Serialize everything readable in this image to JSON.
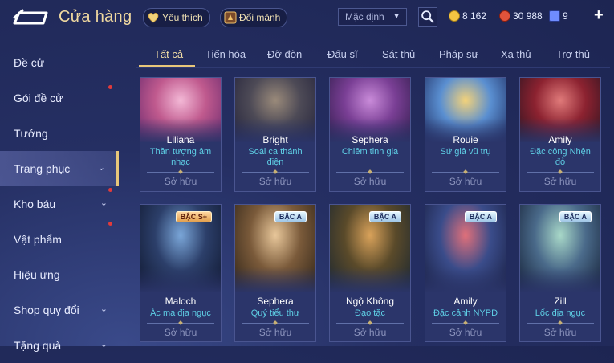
{
  "header": {
    "title": "Cửa hàng",
    "favorites_label": "Yêu thích",
    "exchange_label": "Đổi mảnh",
    "sort_selected": "Mặc định",
    "currencies": [
      {
        "name": "gold-coin",
        "value": "8 162",
        "color": "#f5c542"
      },
      {
        "name": "red-gem",
        "value": "30 988",
        "color": "#e2533b"
      },
      {
        "name": "voucher",
        "value": "9",
        "color": "#6f8cff"
      }
    ]
  },
  "sidebar": {
    "items": [
      {
        "label": "Đề cử"
      },
      {
        "label": "Gói đề cử"
      },
      {
        "label": "Tướng"
      },
      {
        "label": "Trang phục"
      },
      {
        "label": "Kho báu"
      },
      {
        "label": "Vật phẩm"
      },
      {
        "label": "Hiệu ứng"
      },
      {
        "label": "Shop quy đổi"
      },
      {
        "label": "Tặng quà"
      }
    ]
  },
  "tabs": [
    "Tất cả",
    "Tiến hóa",
    "Đỡ đòn",
    "Đấu sĩ",
    "Sát thủ",
    "Pháp sư",
    "Xạ thủ",
    "Trợ thủ"
  ],
  "owned_label": "Sở hữu",
  "cards": [
    {
      "hero": "Liliana",
      "skin": "Thần tượng âm nhạc",
      "badge": "",
      "palette": [
        "#f3b8d6",
        "#c05a8e",
        "#6a2a6e"
      ]
    },
    {
      "hero": "Bright",
      "skin": "Soái ca thánh điện",
      "badge": "",
      "palette": [
        "#9a8a7a",
        "#4d4a56",
        "#23223a"
      ]
    },
    {
      "hero": "Sephera",
      "skin": "Chiêm tinh gia",
      "badge": "",
      "palette": [
        "#c98bd9",
        "#7a3f95",
        "#2f1c4a"
      ]
    },
    {
      "hero": "Rouie",
      "skin": "Sứ giả vũ trụ",
      "badge": "",
      "palette": [
        "#f3d27a",
        "#5a8fd1",
        "#1f2d62"
      ]
    },
    {
      "hero": "Amily",
      "skin": "Đặc công Nhện đỏ",
      "badge": "",
      "palette": [
        "#e07a7a",
        "#8c2230",
        "#2a1420"
      ]
    },
    {
      "hero": "Maloch",
      "skin": "Ác ma địa ngục",
      "badge": "BẬC S+",
      "palette": [
        "#7aa6d8",
        "#2c3f6a",
        "#101830"
      ]
    },
    {
      "hero": "Sephera",
      "skin": "Quý tiểu thư",
      "badge": "BẬC A",
      "palette": [
        "#e8c79a",
        "#7a5a3a",
        "#2f2418"
      ]
    },
    {
      "hero": "Ngộ Không",
      "skin": "Đạo tặc",
      "badge": "BẬC A",
      "palette": [
        "#d9a25a",
        "#5a4a2a",
        "#1a2630"
      ]
    },
    {
      "hero": "Amily",
      "skin": "Đặc cảnh NYPD",
      "badge": "BẬC A",
      "palette": [
        "#e0707a",
        "#3a4c8a",
        "#1a2044"
      ]
    },
    {
      "hero": "Zill",
      "skin": "Lốc địa ngục",
      "badge": "BẬC A",
      "palette": [
        "#a8d8c8",
        "#4a6a8a",
        "#162238"
      ]
    }
  ]
}
